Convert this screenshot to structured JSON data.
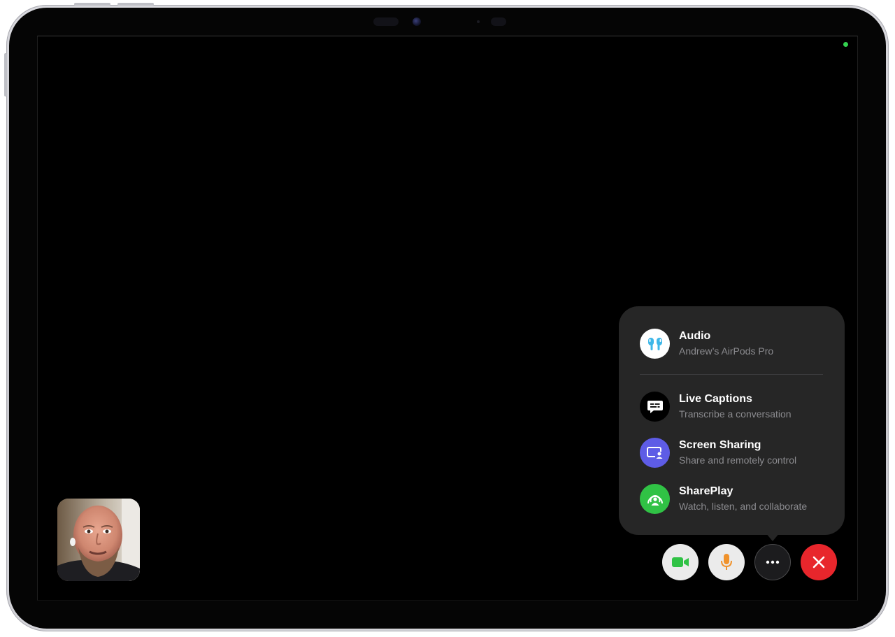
{
  "menu": {
    "items": [
      {
        "title": "Audio",
        "subtitle": "Andrew’s AirPods Pro",
        "icon": "airpods-icon",
        "icon_bg": "#ffffff"
      },
      {
        "title": "Live Captions",
        "subtitle": "Transcribe a conversation",
        "icon": "captions-icon",
        "icon_bg": "#000000"
      },
      {
        "title": "Screen Sharing",
        "subtitle": "Share and remotely control",
        "icon": "screen-share-icon",
        "icon_bg": "#5e5ce6"
      },
      {
        "title": "SharePlay",
        "subtitle": "Watch, listen, and collaborate",
        "icon": "shareplay-icon",
        "icon_bg": "#30c245"
      }
    ]
  },
  "controls": {
    "video": {
      "icon": "video-camera-icon",
      "color": "#30c245"
    },
    "mic": {
      "icon": "microphone-icon",
      "color": "#f0922b"
    },
    "more": {
      "icon": "more-icon"
    },
    "end": {
      "icon": "end-call-icon",
      "color": "#e8262c"
    }
  },
  "colors": {
    "menu_bg": "#262626",
    "status_indicator": "#33d14f"
  }
}
